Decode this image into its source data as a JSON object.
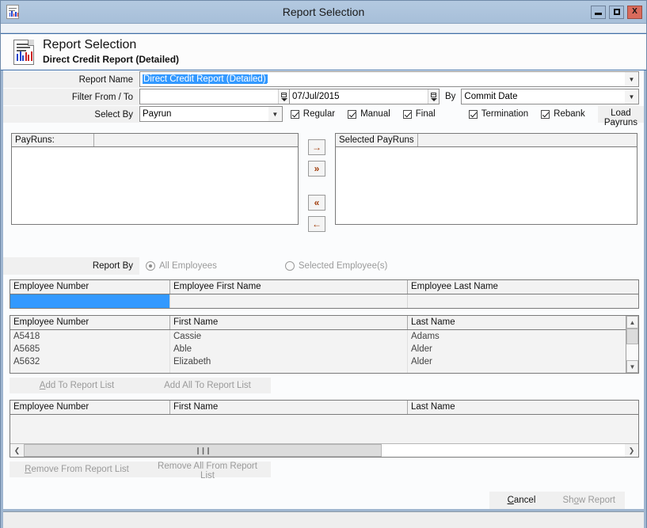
{
  "window": {
    "title": "Report Selection",
    "icon": "report-document-icon",
    "minimize_label": "–",
    "maximize_label": "□",
    "close_label": "X"
  },
  "banner": {
    "icon": "report-document-icon",
    "title": "Report Selection",
    "subtitle": "Direct Credit Report (Detailed)"
  },
  "form": {
    "report_name": {
      "label": "Report Name",
      "value": "Direct Credit Report (Detailed)",
      "dropdown_icon": "chevron-down-icon"
    },
    "filter_from_to": {
      "label": "Filter From / To",
      "from_value": "",
      "to_value": "07/Jul/2015",
      "spinner_icon": "calendar-spinner-icon"
    },
    "by": {
      "label": "By",
      "value": "Commit Date",
      "dropdown_icon": "chevron-down-icon"
    },
    "select_by": {
      "label": "Select By",
      "value": "Payrun",
      "dropdown_icon": "chevron-down-icon"
    },
    "checkboxes": [
      {
        "label": "Regular",
        "checked": true
      },
      {
        "label": "Manual",
        "checked": true
      },
      {
        "label": "Final",
        "checked": true
      },
      {
        "label": "Termination",
        "checked": true
      },
      {
        "label": "Rebank",
        "checked": true
      }
    ],
    "load_payruns_label": "Load Payruns"
  },
  "payruns": {
    "available_header": "PayRuns:",
    "selected_header": "Selected PayRuns",
    "available_items": [],
    "selected_items": [],
    "buttons": [
      {
        "name": "move-right-button",
        "glyph": "→"
      },
      {
        "name": "move-all-right-button",
        "glyph": "»"
      },
      {
        "name": "move-all-left-button",
        "glyph": "«"
      },
      {
        "name": "move-left-button",
        "glyph": "←"
      }
    ]
  },
  "report_by": {
    "label": "Report By",
    "options": [
      {
        "label": "All Employees",
        "selected": true
      },
      {
        "label": "Selected Employee(s)",
        "selected": false
      }
    ]
  },
  "filter_grid": {
    "columns": [
      "Employee Number",
      "Employee First Name",
      "Employee Last Name"
    ],
    "filter_values": [
      "",
      "",
      ""
    ],
    "selected_column_index": 0,
    "selection_color": "#3399ff"
  },
  "employee_grid": {
    "columns": [
      "Employee Number",
      "First Name",
      "Last Name"
    ],
    "rows": [
      [
        "A5418",
        "Cassie",
        "Adams"
      ],
      [
        "A5685",
        "Able",
        "Alder"
      ],
      [
        "A5632",
        "Elizabeth",
        "Alder"
      ]
    ],
    "scroll_up_icon": "chevron-up-icon",
    "scroll_down_icon": "chevron-down-icon"
  },
  "add_buttons": {
    "add_to_report_list": "Add To Report List",
    "add_all_to_report_list": "Add All To Report List"
  },
  "report_list_grid": {
    "columns": [
      "Employee Number",
      "First Name",
      "Last Name"
    ],
    "rows": [],
    "hscroll_left_icon": "chevron-left-icon",
    "hscroll_right_icon": "chevron-right-icon",
    "hscroll_grip": "❙❙❙"
  },
  "remove_buttons": {
    "remove_from_report_list": "Remove From Report List",
    "remove_all_from_report_list": "Remove All From Report List"
  },
  "footer": {
    "cancel_label": "Cancel",
    "show_report_label": "Show Report"
  }
}
